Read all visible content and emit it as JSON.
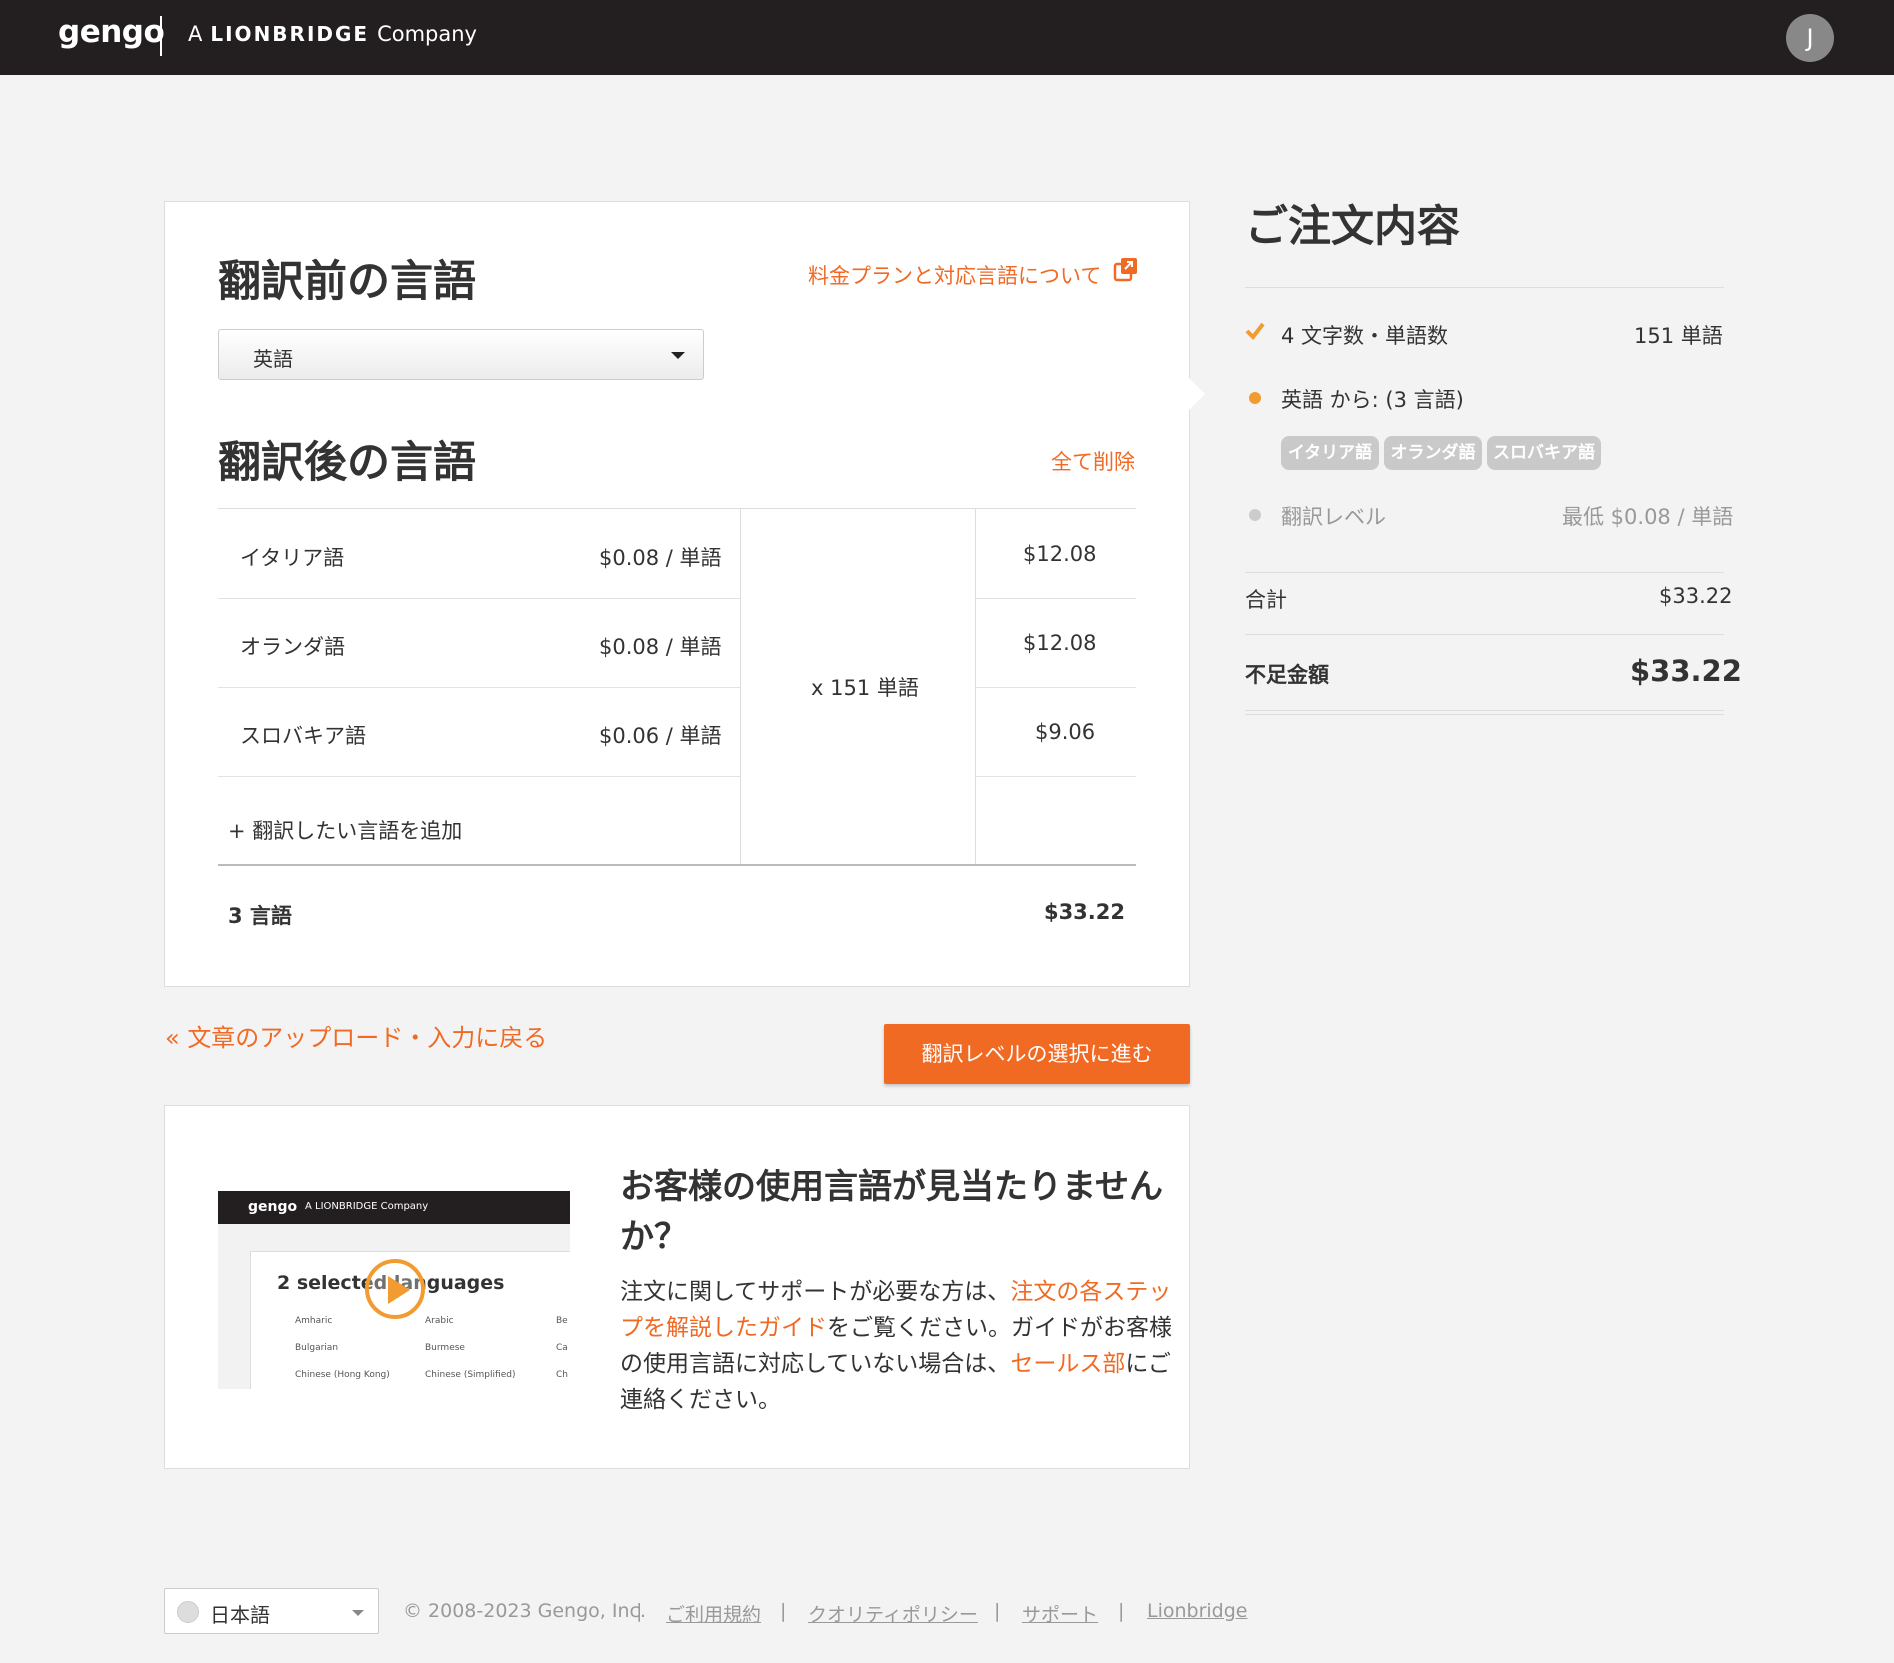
{
  "header": {
    "logo": "gengo",
    "tagline_a": "A",
    "tagline_brand": "LIONBRIDGE",
    "tagline_company": "Company",
    "avatar_initial": "J"
  },
  "source": {
    "title": "翻訳前の言語",
    "pricing_link": "料金プランと対応言語について",
    "selected_language": "英語"
  },
  "target": {
    "title": "翻訳後の言語",
    "clear_all": "全て削除",
    "rows": [
      {
        "language": "イタリア語",
        "rate": "$0.08 / 単語",
        "subtotal": "$12.08"
      },
      {
        "language": "オランダ語",
        "rate": "$0.08 / 単語",
        "subtotal": "$12.08"
      },
      {
        "language": "スロバキア語",
        "rate": "$0.06 / 単語",
        "subtotal": "$9.06"
      }
    ],
    "multiplier": "x 151 単語",
    "add_language": "+ 翻訳したい言語を追加",
    "total_languages": "3 言語",
    "total_amount": "$33.22"
  },
  "nav": {
    "back_link": "« 文章のアップロード・入力に戻る",
    "next_button": "翻訳レベルの選択に進む"
  },
  "help": {
    "video": {
      "logo": "gengo",
      "tagline": "A LIONBRIDGE Company",
      "heading": "2 selected languages",
      "items": [
        "Amharic",
        "Arabic",
        "Be",
        "Bulgarian",
        "Burmese",
        "Ca",
        "Chinese (Hong Kong)",
        "Chinese (Simplified)",
        "Ch"
      ]
    },
    "title": "お客様の使用言語が見当たりませんか？",
    "body_1": "注文に関してサポートが必要な方は、",
    "body_link_1": "注文の各ステップを解説したガイド",
    "body_2": "をご覧ください。ガイドがお客様の使用言語に対応していない場合は、",
    "body_link_2": "セールス部",
    "body_3": "にご連絡ください。"
  },
  "summary": {
    "title": "ご注文内容",
    "word_count_label": "4 文字数・単語数",
    "word_count_value": "151 単語",
    "from_label": "英語 から: (3 言語)",
    "pills": [
      "イタリア語",
      "オランダ語",
      "スロバキア語"
    ],
    "level_label": "翻訳レベル",
    "level_value": "最低 $0.08 / 単語",
    "total_label": "合計",
    "total_value": "$33.22",
    "balance_label": "不足金額",
    "balance_value": "$33.22"
  },
  "footer": {
    "language": "日本語",
    "copyright": "© 2008-2023 Gengo, Inc.",
    "separator": "|",
    "links": [
      "ご利用規約",
      "クオリティポリシー",
      "サポート",
      "Lionbridge"
    ]
  },
  "colors": {
    "accent": "#f06a24",
    "header_bg": "#231f20",
    "pill_bg": "#c9c9c9"
  }
}
